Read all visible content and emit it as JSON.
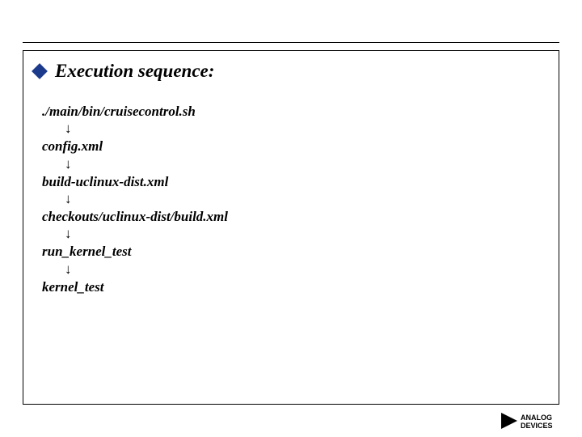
{
  "heading": "Execution sequence:",
  "bullet_icon": "diamond-navy",
  "sequence": {
    "arrow_glyph": "↓",
    "steps": [
      "./main/bin/cruisecontrol.sh",
      "config.xml",
      "build-uclinux-dist.xml",
      "checkouts/uclinux-dist/build.xml",
      "run_kernel_test",
      "kernel_test"
    ]
  },
  "logo": {
    "name": "Analog Devices",
    "top_text": "ANALOG",
    "bottom_text": "DEVICES",
    "accent_color": "#000000"
  }
}
